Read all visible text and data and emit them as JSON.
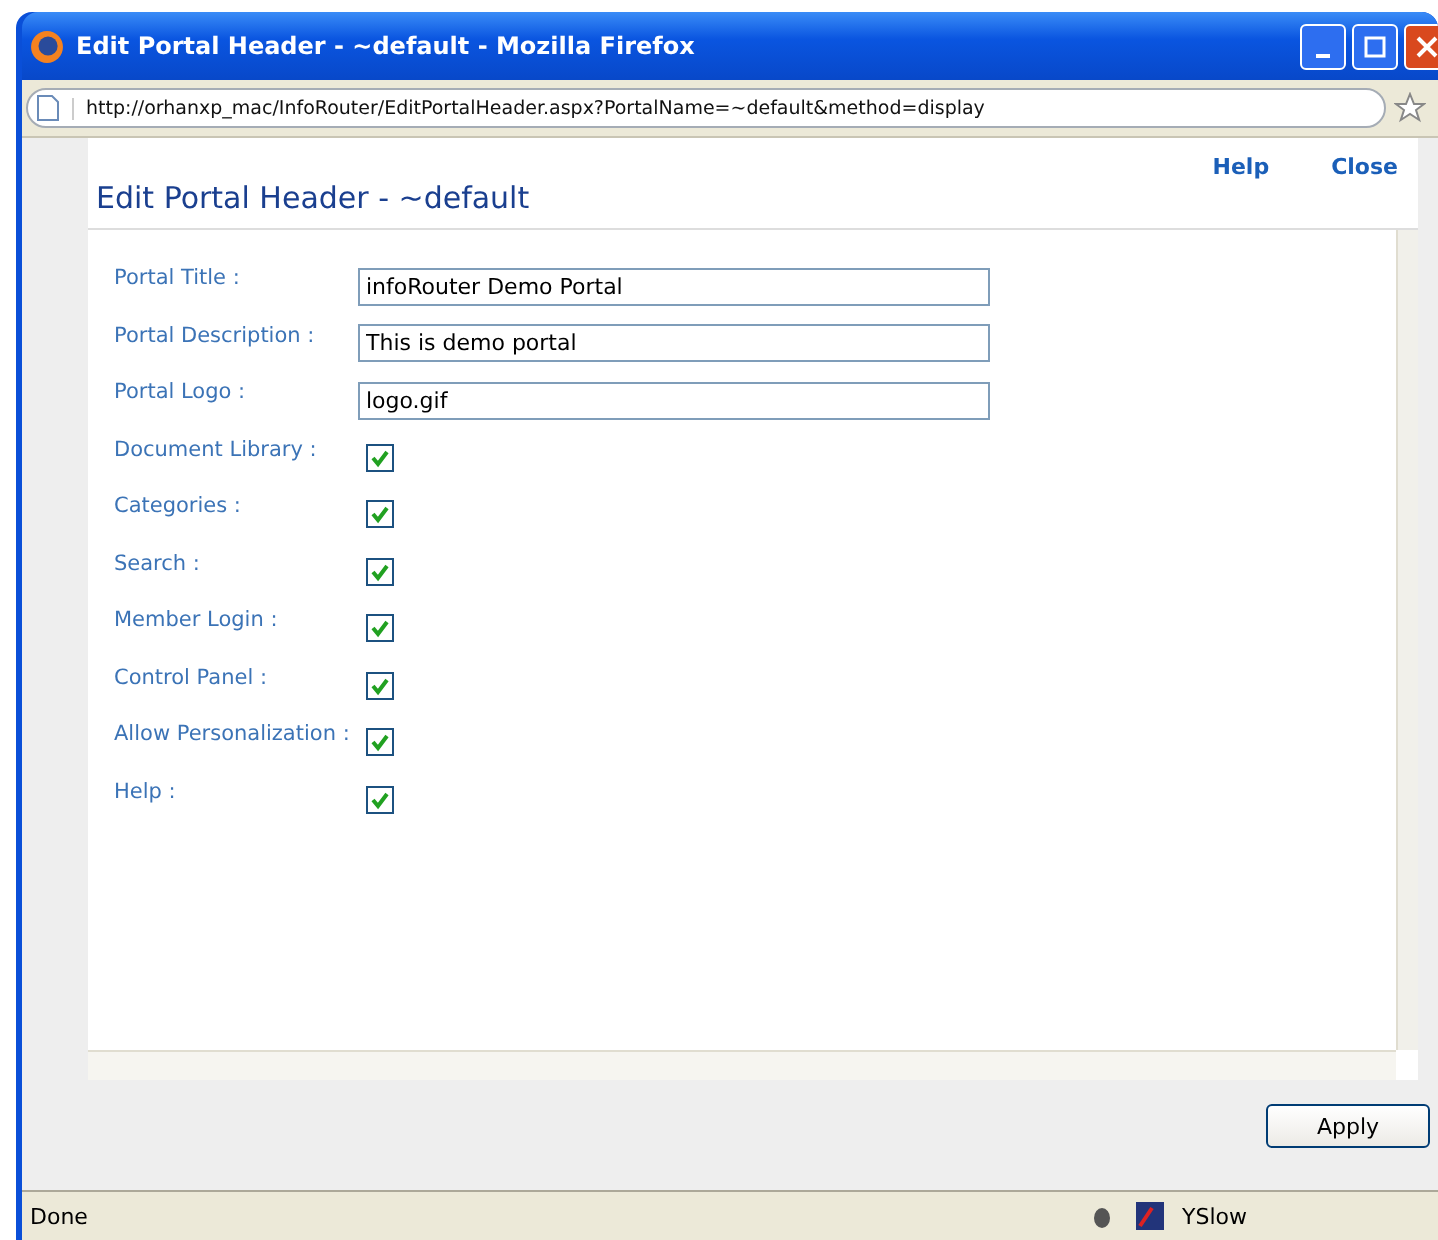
{
  "window": {
    "title": "Edit Portal Header - ~default - Mozilla Firefox"
  },
  "address_bar": {
    "url": "http://orhanxp_mac/InfoRouter/EditPortalHeader.aspx?PortalName=~default&method=display"
  },
  "header_links": [
    "Help",
    "Close"
  ],
  "page_title": "Edit Portal Header - ~default",
  "fields": [
    {
      "kind": "text",
      "label": "Portal Title :",
      "value": "infoRouter Demo Portal"
    },
    {
      "kind": "text",
      "label": "Portal Description :",
      "value": "This is demo portal"
    },
    {
      "kind": "text",
      "label": "Portal Logo :",
      "value": "logo.gif"
    },
    {
      "kind": "checkbox",
      "label": "Document Library :",
      "checked": true
    },
    {
      "kind": "checkbox",
      "label": "Categories :",
      "checked": true
    },
    {
      "kind": "checkbox",
      "label": "Search :",
      "checked": true
    },
    {
      "kind": "checkbox",
      "label": "Member Login :",
      "checked": true
    },
    {
      "kind": "checkbox",
      "label": "Control Panel :",
      "checked": true
    },
    {
      "kind": "checkbox",
      "label": "Allow Personalization :",
      "checked": true
    },
    {
      "kind": "checkbox",
      "label": "Help :",
      "checked": true
    }
  ],
  "buttons": [
    "Apply"
  ],
  "status_bar": {
    "text": "Done",
    "yslow": "YSlow"
  }
}
